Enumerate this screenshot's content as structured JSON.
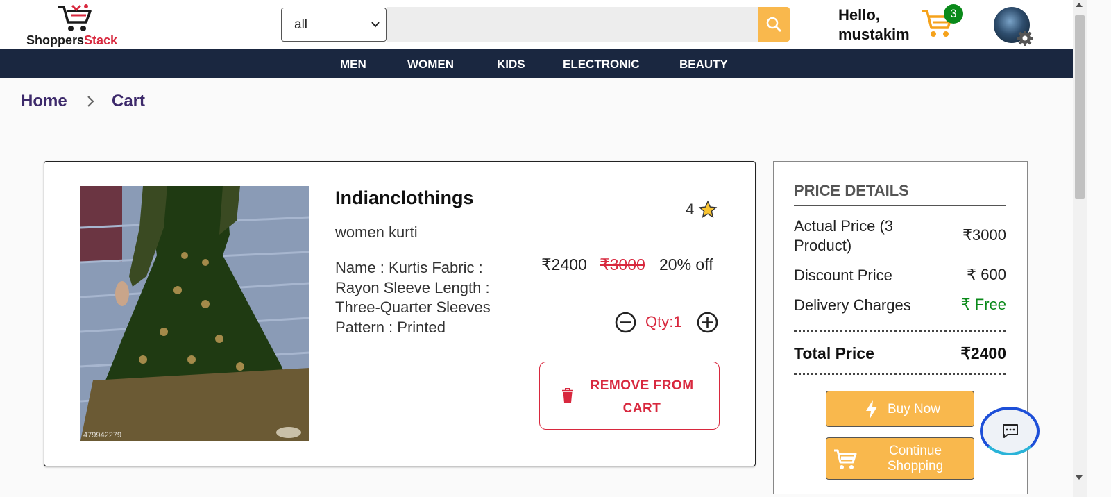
{
  "header": {
    "logo_text_part1": "Shoppers",
    "logo_text_part2": "Stack",
    "category_select": "all",
    "search_placeholder": "",
    "greeting_line1": "Hello,",
    "greeting_line2": "mustakim",
    "cart_count": "3"
  },
  "nav": {
    "items": [
      "MEN",
      "WOMEN",
      "KIDS",
      "ELECTRONIC",
      "BEAUTY"
    ]
  },
  "breadcrumb": {
    "home": "Home",
    "current": "Cart"
  },
  "product": {
    "brand": "Indianclothings",
    "rating": "4",
    "subtitle": "women kurti",
    "description": "Name : Kurtis Fabric : Rayon Sleeve Length : Three-Quarter Sleeves Pattern : Printed",
    "price": "₹2400",
    "mrp": "₹3000",
    "discount": "20% off",
    "quantity": "Qty:1",
    "remove_label": "REMOVE FROM CART",
    "image_code": "479942279"
  },
  "price_details": {
    "title": "PRICE DETAILS",
    "actual_label": "Actual Price (3 Product)",
    "actual_value": "₹3000",
    "discount_label": "Discount Price",
    "discount_value": "₹ 600",
    "delivery_label": "Delivery Charges",
    "delivery_value": "₹ Free",
    "total_label": "Total Price",
    "total_value": "₹2400",
    "buy_now": "Buy Now",
    "continue_shopping": "Continue Shopping"
  },
  "colors": {
    "nav_bg": "#1a2740",
    "accent": "#f9b84d",
    "danger": "#d8283e",
    "success": "#0a8a1a",
    "breadcrumb": "#3d2a6b"
  },
  "icons": [
    "shopping-cart-logo-icon",
    "chevron-down-icon",
    "search-icon",
    "cart-icon",
    "avatar",
    "gear-icon",
    "chevron-right-icon",
    "star-icon",
    "minus-circle-icon",
    "plus-circle-icon",
    "trash-icon",
    "lightning-icon",
    "cart-icon",
    "chat-icon"
  ]
}
